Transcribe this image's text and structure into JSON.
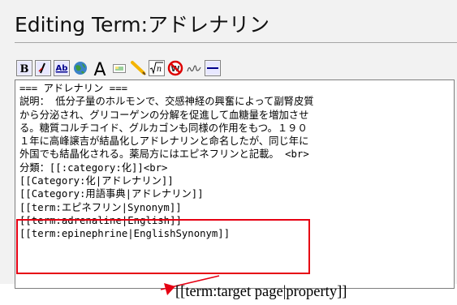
{
  "page": {
    "title": "Editing Term:アドレナリン"
  },
  "toolbar": {
    "buttons": [
      {
        "name": "bold-button",
        "icon": "bold-icon",
        "glyph": "B"
      },
      {
        "name": "italic-button",
        "icon": "italic-icon",
        "glyph": "I"
      },
      {
        "name": "link-button",
        "icon": "internal-link-icon",
        "glyph": "Ab"
      },
      {
        "name": "external-link-button",
        "icon": "globe-icon"
      },
      {
        "name": "headline-button",
        "icon": "headline-icon",
        "glyph": "A"
      },
      {
        "name": "image-button",
        "icon": "image-icon"
      },
      {
        "name": "media-button",
        "icon": "media-icon"
      },
      {
        "name": "math-button",
        "icon": "math-formula-icon",
        "glyph": "√n"
      },
      {
        "name": "nowiki-button",
        "icon": "nowiki-icon"
      },
      {
        "name": "signature-button",
        "icon": "signature-icon"
      },
      {
        "name": "horizontal-line-button",
        "icon": "horizontal-line-icon"
      }
    ]
  },
  "editor": {
    "lines": [
      "=== アドレナリン ===",
      "説明： 低分子量のホルモンで、交感神経の興奮によって副腎皮質",
      "から分泌され、グリコーゲンの分解を促進して血糖量を増加させ",
      "る。糖質コルチコイド、グルカゴンも同様の作用をもつ。１９０",
      "１年に高峰譲吉が結晶化しアドレナリンと命名したが、同じ年に",
      "外国でも結晶化される。薬局方にはエピネフリンと記載。 <br>",
      "分類：[[:category:化]]<br>",
      "[[Category:化|アドレナリン]]",
      "[[Category:用語事典|アドレナリン]]",
      "[[term:エピネフリン|Synonym]]",
      "[[term:adrenaline|English]]",
      "[[term:epinephrine|EnglishSynonym]]"
    ]
  },
  "annotation": {
    "label": "[[term:target page|property]]",
    "color": "#e60012"
  }
}
